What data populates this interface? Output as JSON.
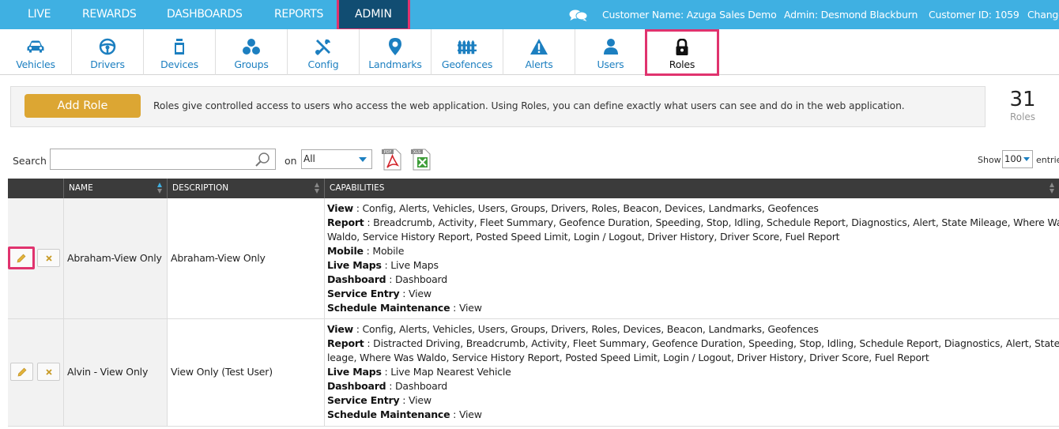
{
  "topnav": {
    "items": [
      "LIVE",
      "REWARDS",
      "DASHBOARDS",
      "REPORTS",
      "ADMIN"
    ],
    "active": "ADMIN",
    "customer_name": "Customer Name: Azuga Sales Demo",
    "admin_name": "Admin: Desmond Blackburn",
    "customer_id": "Customer ID: 1059",
    "change": "Change"
  },
  "subnav": {
    "items": [
      {
        "label": "Vehicles",
        "icon": "car-icon"
      },
      {
        "label": "Drivers",
        "icon": "steering-wheel-icon"
      },
      {
        "label": "Devices",
        "icon": "device-icon"
      },
      {
        "label": "Groups",
        "icon": "groups-icon"
      },
      {
        "label": "Config",
        "icon": "tools-icon"
      },
      {
        "label": "Landmarks",
        "icon": "map-pin-icon"
      },
      {
        "label": "Geofences",
        "icon": "fence-icon"
      },
      {
        "label": "Alerts",
        "icon": "warning-icon"
      },
      {
        "label": "Users",
        "icon": "user-icon"
      },
      {
        "label": "Roles",
        "icon": "lock-icon"
      }
    ],
    "active": "Roles"
  },
  "rolebar": {
    "add_role_label": "Add Role",
    "description": "Roles give controlled access to users who access the web application. Using Roles, you can define exactly what users can see and do in the web application.",
    "count": "31",
    "count_label": "Roles"
  },
  "toolbar": {
    "search_label": "Search :",
    "search_value": "",
    "on_label": "on :",
    "on_value": "All",
    "show_label": "Show",
    "show_value": "100",
    "entries_label": "entries"
  },
  "table": {
    "headers": [
      "NAME",
      "DESCRIPTION",
      "CAPABILITIES"
    ],
    "rows": [
      {
        "name": "Abraham-View Only",
        "description": "Abraham-View Only",
        "capabilities": [
          {
            "key": "View",
            "value": " : Config, Alerts, Vehicles, Users, Groups, Drivers, Roles, Beacon, Devices, Landmarks, Geofences"
          },
          {
            "key": "Report",
            "value": " : Breadcrumb, Activity, Fleet Summary, Geofence Duration, Speeding, Stop, Idling, Schedule Report, Diagnostics, Alert, State Mileage, Where Was"
          },
          {
            "key": "",
            "value": "Waldo, Service History Report, Posted Speed Limit, Login / Logout, Driver History, Driver Score, Fuel Report"
          },
          {
            "key": "Mobile",
            "value": " : Mobile"
          },
          {
            "key": "Live Maps",
            "value": " : Live Maps"
          },
          {
            "key": "Dashboard",
            "value": " : Dashboard"
          },
          {
            "key": "Service Entry",
            "value": " : View"
          },
          {
            "key": "Schedule Maintenance",
            "value": " : View"
          }
        ]
      },
      {
        "name": "Alvin - View Only",
        "description": "View Only (Test User)",
        "capabilities": [
          {
            "key": "View",
            "value": " : Config, Alerts, Vehicles, Users, Groups, Drivers, Roles, Devices, Beacon, Landmarks, Geofences"
          },
          {
            "key": "Report",
            "value": " : Distracted Driving, Breadcrumb, Activity, Fleet Summary, Geofence Duration, Speeding, Stop, Idling, Schedule Report, Diagnostics, Alert, State Mi"
          },
          {
            "key": "",
            "value": "leage, Where Was Waldo, Service History Report, Posted Speed Limit, Login / Logout, Driver History, Driver Score, Fuel Report"
          },
          {
            "key": "Live Maps",
            "value": " : Live Map Nearest Vehicle"
          },
          {
            "key": "Dashboard",
            "value": " : Dashboard"
          },
          {
            "key": "Service Entry",
            "value": " : View"
          },
          {
            "key": "Schedule Maintenance",
            "value": " : View"
          }
        ]
      }
    ]
  },
  "colors": {
    "topbar": "#3fb0e2",
    "admin_active": "#114d72",
    "highlight": "#e0336e",
    "add_role": "#dca633",
    "nav_text": "#1c7fc0",
    "table_header": "#3b3b3b"
  }
}
